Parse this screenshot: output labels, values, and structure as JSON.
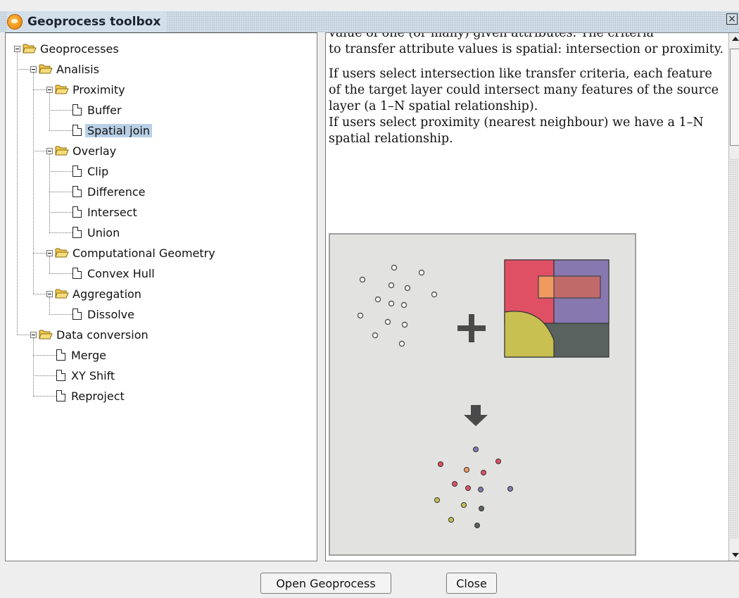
{
  "window": {
    "title": "Geoprocess toolbox",
    "close_glyph": "×"
  },
  "tree": {
    "nodes": [
      {
        "label": "Geoprocesses",
        "type": "folder"
      },
      {
        "label": "Analisis",
        "type": "folder"
      },
      {
        "label": "Proximity",
        "type": "folder"
      },
      {
        "label": "Buffer",
        "type": "file"
      },
      {
        "label": "Spatial join",
        "type": "file",
        "selected": true
      },
      {
        "label": "Overlay",
        "type": "folder"
      },
      {
        "label": "Clip",
        "type": "file"
      },
      {
        "label": "Difference",
        "type": "file"
      },
      {
        "label": "Intersect",
        "type": "file"
      },
      {
        "label": "Union",
        "type": "file"
      },
      {
        "label": "Computational Geometry",
        "type": "folder"
      },
      {
        "label": "Convex Hull",
        "type": "file"
      },
      {
        "label": "Aggregation",
        "type": "folder"
      },
      {
        "label": "Dissolve",
        "type": "file"
      },
      {
        "label": "Data conversion",
        "type": "folder"
      },
      {
        "label": "Merge",
        "type": "file"
      },
      {
        "label": "XY Shift",
        "type": "file"
      },
      {
        "label": "Reproject",
        "type": "file"
      }
    ]
  },
  "help": {
    "cut_top_line": "value of one (or many) given attributes. The criteria",
    "p1": "to transfer attribute values is spatial: intersection or proximity.",
    "p2": "If users select intersection like transfer criteria, each feature of the target layer could intersect many features of the source layer (a 1–N spatial relationship).",
    "p3": "If users select proximity (nearest neighbour) we have a 1–N spatial relationship."
  },
  "figure": {
    "colors": {
      "red": "#e05065",
      "purple": "#8878b0",
      "olive": "#c8c050",
      "dark": "#5a6260",
      "orange": "#f09a60",
      "arrow": "#4a4a4a"
    }
  },
  "buttons": {
    "open": "Open Geoprocess",
    "close": "Close"
  }
}
